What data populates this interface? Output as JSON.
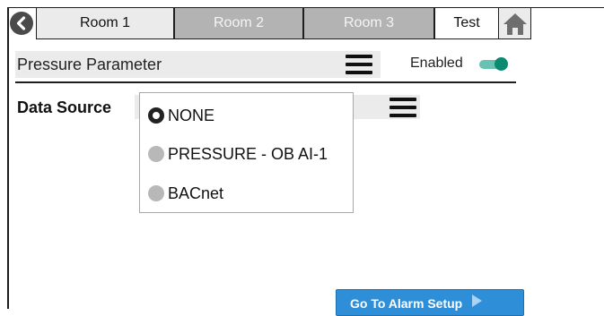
{
  "tabs": [
    {
      "label": "Room 1",
      "state": "selected"
    },
    {
      "label": "Room 2",
      "state": "inactive"
    },
    {
      "label": "Room 3",
      "state": "inactive"
    },
    {
      "label": "Test",
      "state": "active"
    }
  ],
  "icons": {
    "back": "chevron-left-icon",
    "home": "home-icon",
    "menu": "hamburger-menu-icon"
  },
  "parameter": {
    "title": "Pressure Parameter",
    "enabled_label": "Enabled",
    "enabled": true
  },
  "data_source": {
    "label": "Data Source",
    "selected": "NONE",
    "options": [
      "NONE",
      "PRESSURE - OB AI-1",
      "BACnet"
    ]
  },
  "actions": {
    "alarm_setup": "Go To Alarm Setup"
  },
  "colors": {
    "toggle_on": "#0b8a72",
    "button": "#2f8ed8",
    "tab_inactive": "#b3b3b3"
  }
}
